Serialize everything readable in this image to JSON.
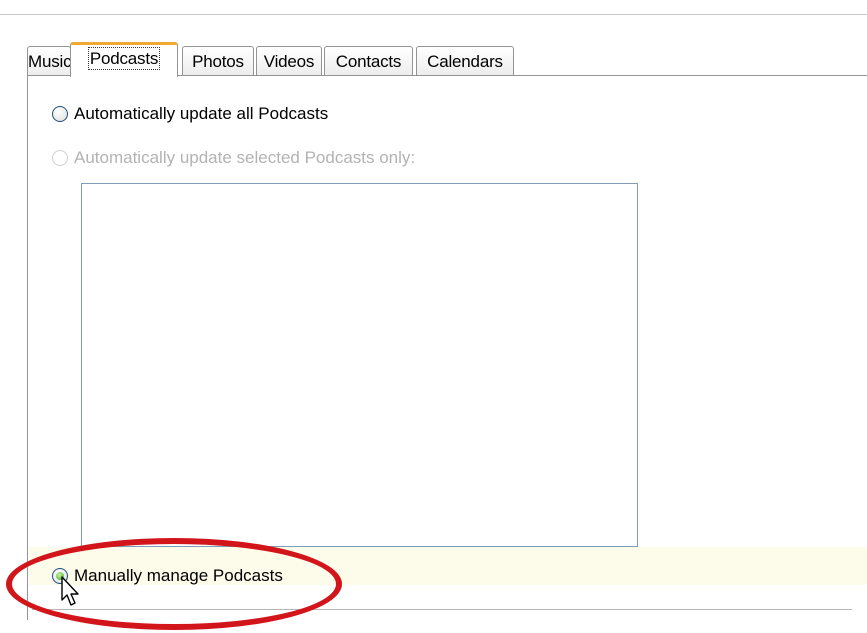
{
  "tabs": [
    {
      "label": "Music",
      "selected": false
    },
    {
      "label": "Podcasts",
      "selected": true
    },
    {
      "label": "Photos",
      "selected": false
    },
    {
      "label": "Videos",
      "selected": false
    },
    {
      "label": "Contacts",
      "selected": false
    },
    {
      "label": "Calendars",
      "selected": false
    }
  ],
  "options": {
    "auto_all": {
      "label": "Automatically update all Podcasts",
      "checked": false,
      "enabled": true
    },
    "auto_selected": {
      "label": "Automatically update selected Podcasts only:",
      "checked": false,
      "enabled": false
    },
    "manual": {
      "label": "Manually manage Podcasts",
      "checked": true,
      "enabled": true
    }
  },
  "colors": {
    "highlight": "#d2141b",
    "selected_tab_accent": "#f2a931"
  },
  "icons": {
    "cursor": "arrow-cursor-icon"
  }
}
